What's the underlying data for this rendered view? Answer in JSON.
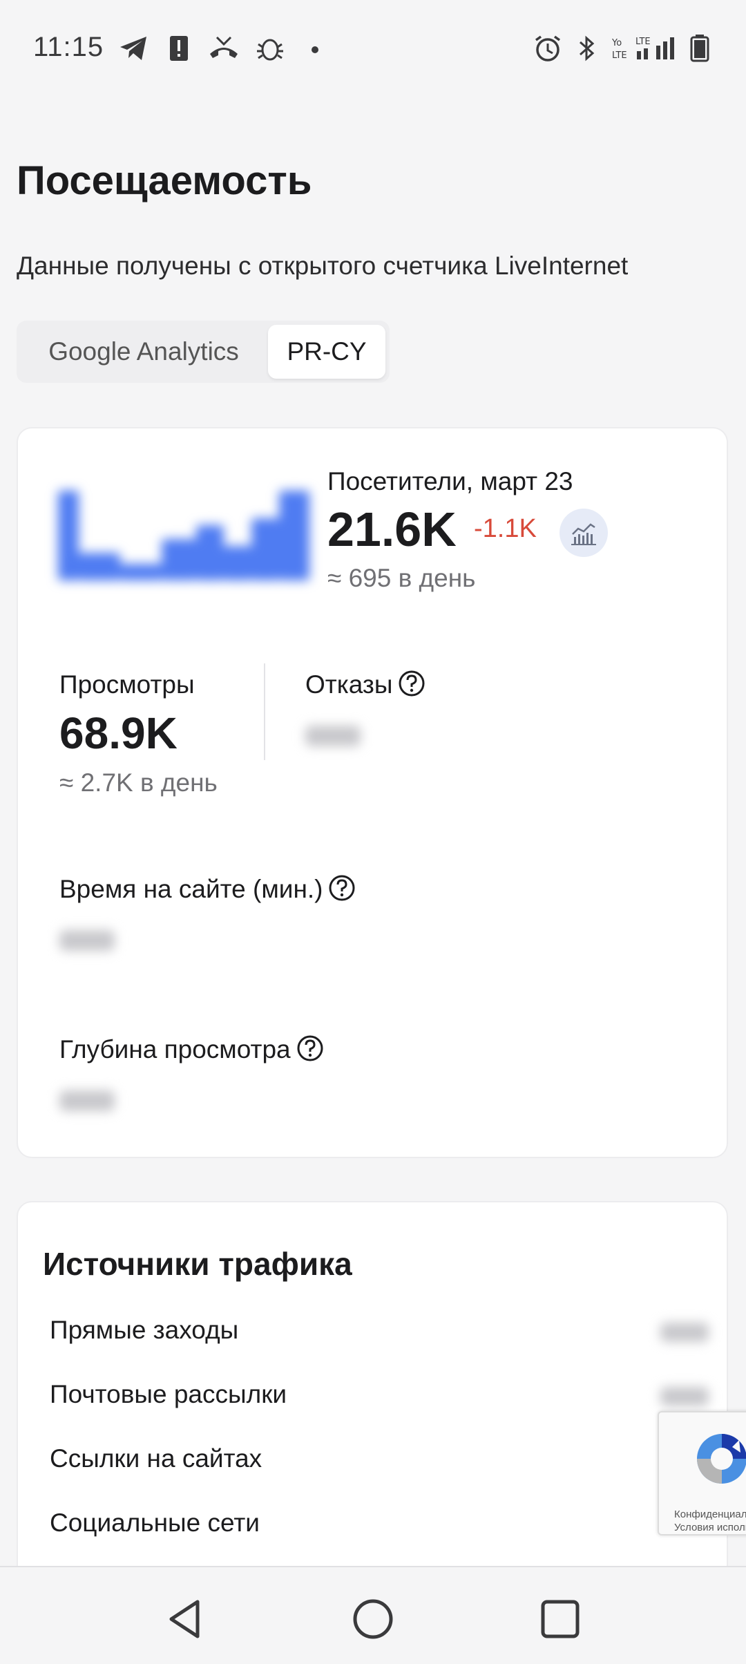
{
  "status_bar": {
    "time": "11:15"
  },
  "page": {
    "title": "Посещаемость",
    "subtitle": "Данные получены с открытого счетчика LiveInternet"
  },
  "tabs": [
    {
      "label": "Google Analytics",
      "active": false
    },
    {
      "label": "PR-CY",
      "active": true
    }
  ],
  "traffic": {
    "visitors_label": "Посетители, март 23",
    "visitors_value": "21.6K",
    "visitors_delta": "-1.1K",
    "visitors_per_day": "≈ 695 в день",
    "views_label": "Просмотры",
    "views_value": "68.9K",
    "views_per_day": "≈ 2.7K в день",
    "bounces_label": "Отказы",
    "time_on_site_label": "Время на сайте (мин.)",
    "depth_label": "Глубина просмотра"
  },
  "sources": {
    "title": "Источники трафика",
    "rows": [
      "Прямые заходы",
      "Почтовые рассылки",
      "Ссылки на сайтах",
      "Социальные сети"
    ]
  },
  "recaptcha": {
    "line1": "Конфиденциальн",
    "line2": "Условия исполь"
  },
  "colors": {
    "accent": "#4f7cf2",
    "negative": "#d84a3a",
    "background": "#f5f5f6"
  }
}
